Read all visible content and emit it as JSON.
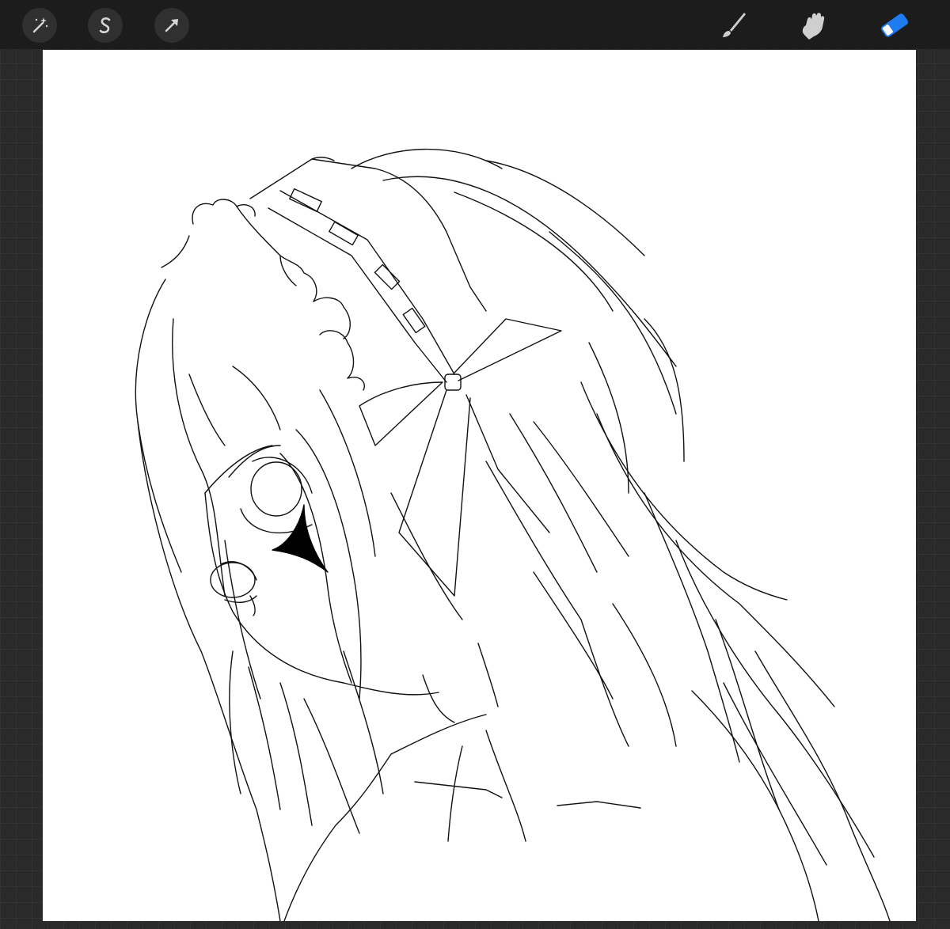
{
  "toolbar": {
    "left_tools": [
      {
        "name": "adjustments",
        "icon": "magic-wand-icon"
      },
      {
        "name": "selection",
        "icon": "selection-s-icon"
      },
      {
        "name": "transform",
        "icon": "arrow-cursor-icon"
      }
    ],
    "right_tools": [
      {
        "name": "paint",
        "icon": "brush-icon",
        "active": false
      },
      {
        "name": "smudge",
        "icon": "finger-smudge-icon",
        "active": false
      },
      {
        "name": "erase",
        "icon": "eraser-icon",
        "active": true
      }
    ],
    "active_color": "#1e7cf2",
    "inactive_color": "#cfcfcf"
  },
  "canvas": {
    "background": "#ffffff",
    "content": "line-art-illustration"
  }
}
